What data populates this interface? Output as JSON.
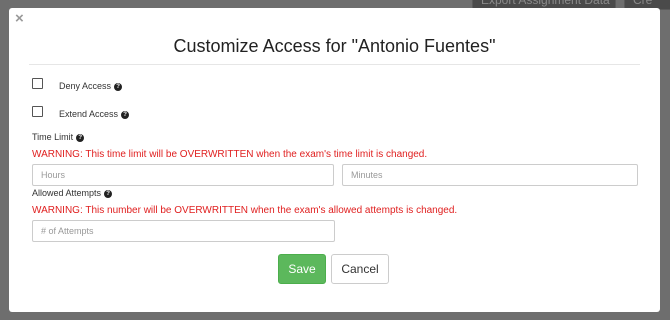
{
  "background": {
    "export_button_label": "Export Assignment Data",
    "other_button_label": "Cre"
  },
  "modal": {
    "close_glyph": "×",
    "title": "Customize Access for \"Antonio Fuentes\"",
    "deny_access": {
      "label": "Deny Access",
      "checked": false
    },
    "extend_access": {
      "label": "Extend Access",
      "checked": false
    },
    "help_glyph": "?",
    "time_limit": {
      "label": "Time Limit",
      "warning": "WARNING: This time limit will be OVERWRITTEN when the exam's time limit is changed.",
      "hours_placeholder": "Hours",
      "minutes_placeholder": "Minutes"
    },
    "allowed_attempts": {
      "label": "Allowed Attempts",
      "warning": "WARNING: This number will be OVERWRITTEN when the exam's allowed attempts is changed.",
      "placeholder": "# of Attempts"
    },
    "save_label": "Save",
    "cancel_label": "Cancel"
  },
  "colors": {
    "save_green": "#5cb85c",
    "warning_red": "#e02020",
    "overlay_gray": "#6e6e6e"
  }
}
